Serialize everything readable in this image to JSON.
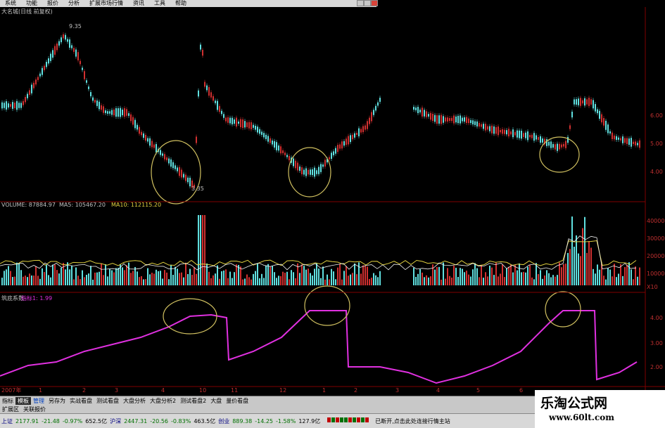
{
  "menu": [
    "系统",
    "功能",
    "报价",
    "分析",
    "扩展市场行情",
    "资讯",
    "工具",
    "帮助"
  ],
  "price_panel": {
    "title": "大名城(日线 前复权)",
    "high_label": "9.35",
    "low_label": "3.35",
    "axis": [
      "6.00",
      "5.00",
      "4.00"
    ]
  },
  "volume_panel": {
    "label": "VOLUME: 87884.97",
    "ma5": "MA5: 105467.20",
    "ma10": "MA10: 112115.20",
    "axis": [
      "40000",
      "30000",
      "20000",
      "10000",
      "X10"
    ]
  },
  "indicator_panel": {
    "name": "筑底系数",
    "label": "指标1: 1.99",
    "axis": [
      "4.00",
      "3.00",
      "2.00"
    ]
  },
  "time_axis": [
    "2007年",
    "1",
    "2",
    "3",
    "4",
    "10",
    "11",
    "12",
    "1",
    "2",
    "3",
    "4",
    "5",
    "6"
  ],
  "tabs": [
    "指标",
    "模板",
    "管理",
    "另存为",
    "实战看盘",
    "测试看盘",
    "大盘分析",
    "大盘分析2",
    "测试看盘2",
    "大盘",
    "量价看盘"
  ],
  "tabs2": [
    "扩展区",
    "关联报价"
  ],
  "status": {
    "sh_name": "上证",
    "sh_val": "2177.91",
    "sh_chg": "-21.48",
    "sh_pct": "-0.97%",
    "sh_amt": "652.5亿",
    "sz_name": "沪深",
    "sz_val": "2447.31",
    "sz_chg": "-20.56",
    "sz_pct": "-0.83%",
    "sz_amt": "463.5亿",
    "cy_name": "创业",
    "cy_val": "889.38",
    "cy_chg": "-14.25",
    "cy_pct": "-1.58%",
    "cy_amt": "127.9亿",
    "msg": "已断开,点击此处连接行情主站"
  },
  "watermark": {
    "title": "乐淘公式网",
    "url": "www.60lt.com"
  },
  "colors": {
    "up": "#d03030",
    "down": "#60e0e0",
    "indicator": "#e030e0",
    "annotation": "#d0c060"
  }
}
